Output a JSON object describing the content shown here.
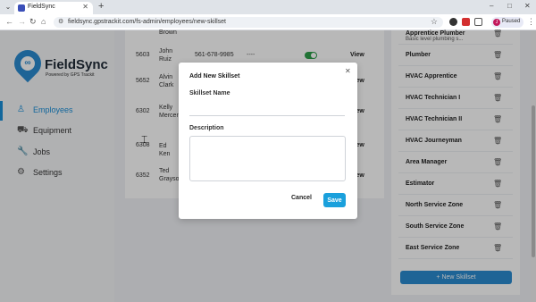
{
  "browser": {
    "tab_title": "FieldSync",
    "url": "fieldsync.gpstrackit.com/fs-admin/employees/new-skillset",
    "profile_initial": "J",
    "profile_status": "Paused"
  },
  "brand": {
    "name": "FieldSync",
    "tagline": "Powered by GPS Trackit"
  },
  "nav": [
    {
      "label": "Employees",
      "icon": "person-icon"
    },
    {
      "label": "Equipment",
      "icon": "truck-icon"
    },
    {
      "label": "Jobs",
      "icon": "wrench-icon"
    },
    {
      "label": "Settings",
      "icon": "gear-icon"
    }
  ],
  "employees": [
    {
      "id": "",
      "name": "Brown",
      "phone": "",
      "dash": "",
      "view": ""
    },
    {
      "id": "5603",
      "name": "John Ruiz",
      "phone": "561-678-9985",
      "dash": "----",
      "view": "View",
      "active": true
    },
    {
      "id": "5652",
      "name": "Alvin Clark",
      "phone": "",
      "dash": "",
      "view": "View"
    },
    {
      "id": "6302",
      "name": "Kelly Mercer",
      "phone": "",
      "dash": "",
      "view": "View"
    },
    {
      "id": "6308",
      "name": "Ed Ken",
      "phone": "",
      "dash": "",
      "view": "View"
    },
    {
      "id": "6352",
      "name": "Ted Grayson",
      "phone": "",
      "dash": "",
      "view": "View"
    }
  ],
  "skills": [
    {
      "name": "Apprentice Plumber",
      "sub": "Basic level plumbing s..."
    },
    {
      "name": "Plumber",
      "sub": ""
    },
    {
      "name": "HVAC Apprentice",
      "sub": ""
    },
    {
      "name": "HVAC Technician I",
      "sub": ""
    },
    {
      "name": "HVAC Technician II",
      "sub": ""
    },
    {
      "name": "HVAC Journeyman",
      "sub": ""
    },
    {
      "name": "Area Manager",
      "sub": ""
    },
    {
      "name": "Estimator",
      "sub": ""
    },
    {
      "name": "North Service Zone",
      "sub": ""
    },
    {
      "name": "South Service Zone",
      "sub": ""
    },
    {
      "name": "East Service Zone",
      "sub": ""
    }
  ],
  "new_skill_button": "+ New Skillset",
  "modal": {
    "title": "Add New Skillset",
    "skill_label": "Skillset Name",
    "skill_value": "",
    "desc_label": "Description",
    "desc_value": "",
    "cancel": "Cancel",
    "save": "Save"
  },
  "colors": {
    "accent": "#1aa0dc",
    "brand": "#2a8bd0",
    "toggle_on": "#2e9f4a"
  }
}
